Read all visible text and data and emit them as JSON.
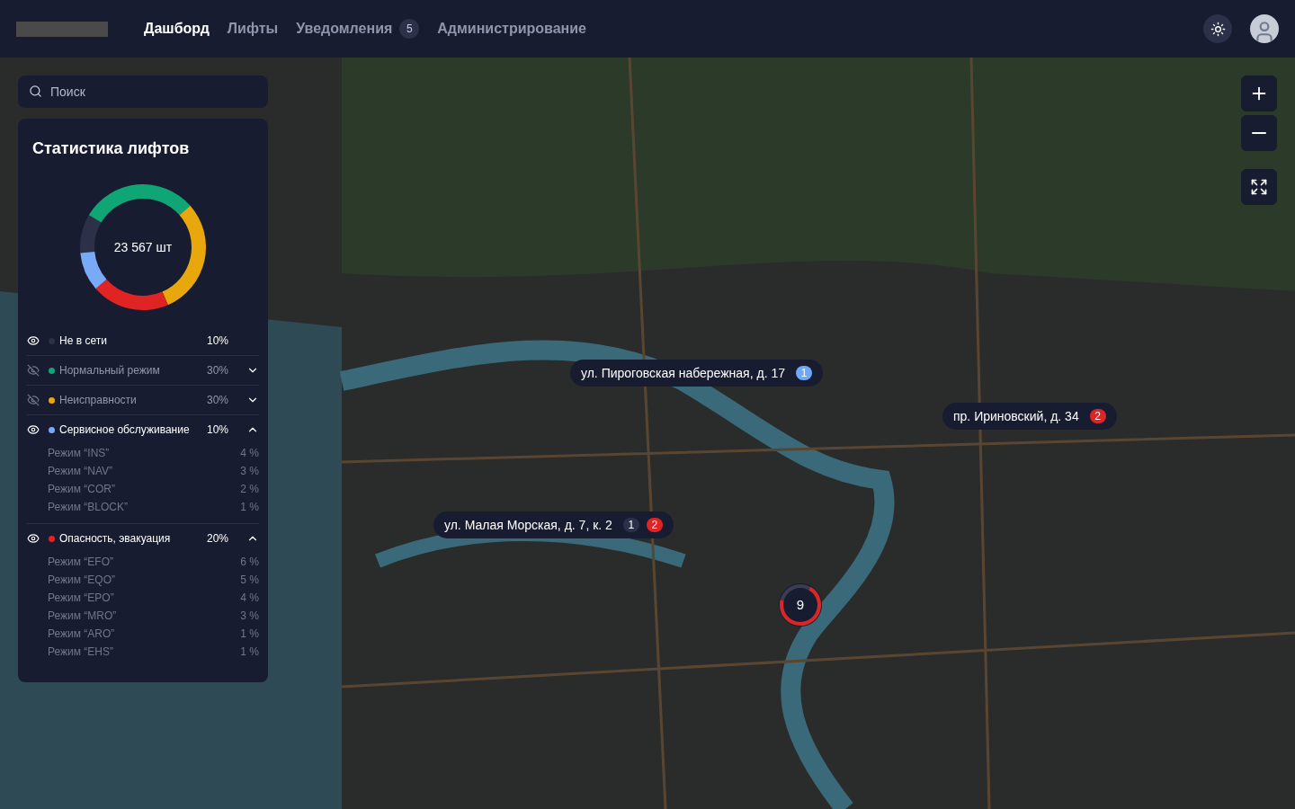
{
  "nav": {
    "tabs": [
      {
        "label": "Дашборд",
        "selected": true
      },
      {
        "label": "Лифты",
        "selected": false
      },
      {
        "label": "Уведомления",
        "selected": false,
        "badge": "5"
      },
      {
        "label": "Администрирование",
        "selected": false
      }
    ]
  },
  "search": {
    "placeholder": "Поиск"
  },
  "stats": {
    "title": "Статистика лифтов",
    "total": "23 567 шт",
    "chart_data": {
      "type": "donut",
      "values": [
        10,
        30,
        30,
        20,
        10
      ],
      "colors": [
        "#2c3049",
        "#10a574",
        "#e8a70c",
        "#e02424",
        "#78aaf8"
      ]
    },
    "items": [
      {
        "label": "Не в сети",
        "value": "10%",
        "color": "#2c3049",
        "visible": true
      },
      {
        "label": "Нормальный режим",
        "value": "30%",
        "color": "#10a574",
        "visible": false,
        "expanded": false
      },
      {
        "label": "Неисправности",
        "value": "30%",
        "color": "#e8a70c",
        "visible": false,
        "expanded": false
      },
      {
        "label": "Сервисное обслуживание",
        "value": "10%",
        "color": "#78aaf8",
        "visible": true,
        "expanded": true,
        "children": [
          {
            "label": "Режим “INS”",
            "value": "4 %"
          },
          {
            "label": "Режим “NAV”",
            "value": "3 %"
          },
          {
            "label": "Режим “COR”",
            "value": "2 %"
          },
          {
            "label": "Режим “BLOCK”",
            "value": "1 %"
          }
        ]
      },
      {
        "label": "Опасность, эвакуация",
        "value": "20%",
        "color": "#e02424",
        "visible": true,
        "expanded": true,
        "children": [
          {
            "label": "Режим “EFO”",
            "value": "6 %"
          },
          {
            "label": "Режим “EQO”",
            "value": "5 %"
          },
          {
            "label": "Режим “EPO”",
            "value": "4 %"
          },
          {
            "label": "Режим “MRO”",
            "value": "3 %"
          },
          {
            "label": "Режим “ARO”",
            "value": "1 %"
          },
          {
            "label": "Режим “EHS”",
            "value": "1 %"
          }
        ]
      }
    ]
  },
  "markers": [
    {
      "kind": "address",
      "label": "ул. Пироговская набережная, д. 17",
      "badges": [
        {
          "text": "1",
          "color": "#6ea8fe"
        }
      ]
    },
    {
      "kind": "address",
      "label": "пр. Ириновский, д. 34",
      "badges": [
        {
          "text": "2",
          "color": "#e02424"
        }
      ]
    },
    {
      "kind": "address",
      "label": "ул. Малая Морская, д. 7, к. 2",
      "badges": [
        {
          "text": "1",
          "color": "#2c3049"
        },
        {
          "text": "2",
          "color": "#e02424"
        }
      ]
    },
    {
      "kind": "cluster",
      "label": "9",
      "level": 0.7
    }
  ]
}
